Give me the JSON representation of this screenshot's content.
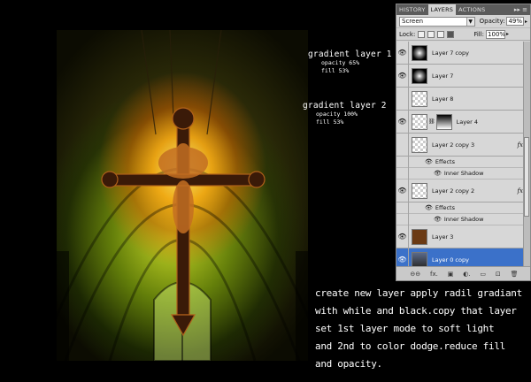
{
  "annotations": {
    "layer1": {
      "title": "gradient layer 1",
      "opacity": "opacity 65%",
      "fill": "fill 53%"
    },
    "layer2": {
      "title": "gradient layer 2",
      "opacity": "opacity 100%",
      "fill": "fill 53%"
    }
  },
  "instructions": [
    "create new layer apply radil gradiant",
    "with while and black.copy that layer",
    "set 1st layer mode to soft light",
    "and 2nd to color dodge.reduce fill",
    "and opacity."
  ],
  "panel": {
    "tabs": [
      {
        "label": "HISTORY",
        "active": false
      },
      {
        "label": "LAYERS",
        "active": true
      },
      {
        "label": "ACTIONS",
        "active": false
      }
    ],
    "menu_glyph": "▸▸ ≡",
    "blend_mode": "Screen",
    "opacity_label": "Opacity:",
    "opacity_value": "49%",
    "lock_label": "Lock:",
    "fill_label": "Fill:",
    "fill_value": "100%",
    "layers": [
      {
        "name": "Layer 7 copy",
        "thumb": "radial",
        "fx": false,
        "selected": false
      },
      {
        "name": "Layer 7",
        "thumb": "radial",
        "fx": false,
        "selected": false
      },
      {
        "name": "Layer 8",
        "thumb": "checker",
        "fx": false,
        "selected": false
      },
      {
        "name": "Layer 4",
        "thumb": "checker",
        "mask": "grad",
        "fx": false,
        "selected": false
      },
      {
        "name": "Layer 2 copy 3",
        "thumb": "checker",
        "fx": true,
        "selected": false,
        "effects": [
          "Effects",
          "Inner Shadow"
        ]
      },
      {
        "name": "Layer 2 copy 2",
        "thumb": "checker",
        "fx": true,
        "selected": false,
        "effects": [
          "Effects",
          "Inner Shadow"
        ]
      },
      {
        "name": "Layer 3",
        "thumb": "brown",
        "fx": false,
        "selected": false
      },
      {
        "name": "Layer 0 copy",
        "thumb": "photo",
        "fx": false,
        "selected": true
      }
    ],
    "fx_glyph": "fx",
    "bottom_icons": [
      "⊖⊖",
      "fx.",
      "▣",
      "◐.",
      "▭",
      "⊡",
      "🗑"
    ]
  },
  "colors": {
    "panel_bg": "#d4d4d4",
    "selection": "#3b71c9",
    "canvas_glow": "#ffb414"
  }
}
